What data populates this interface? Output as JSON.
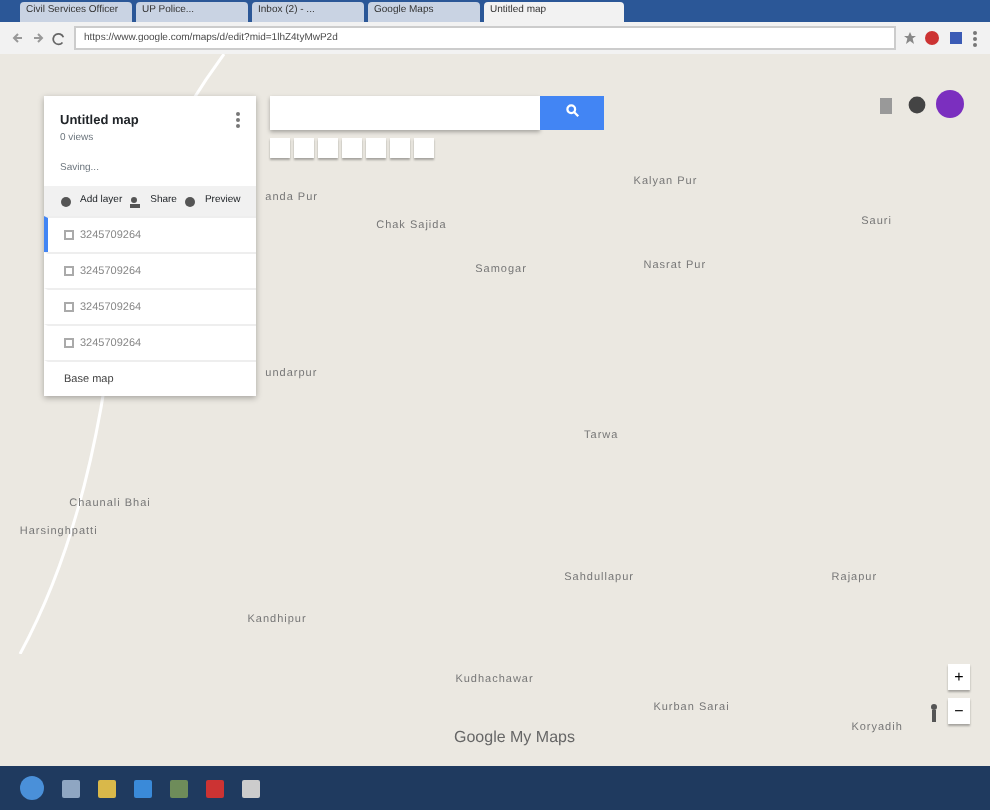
{
  "browser": {
    "tabs": [
      {
        "label": "Civil Services Officer",
        "selected": false
      },
      {
        "label": "UP Police...",
        "selected": false
      },
      {
        "label": "Inbox (2) - ...",
        "selected": false
      },
      {
        "label": "Google Maps",
        "selected": false
      },
      {
        "label": "Untitled map",
        "selected": true
      }
    ],
    "url": "https://www.google.com/maps/d/edit?mid=1lhZ4tyMwP2d"
  },
  "panel": {
    "title": "Untitled map",
    "subtitle": "0 views",
    "status": "Saving...",
    "actions": [
      "Add layer",
      "Share",
      "Preview"
    ],
    "layers": [
      {
        "label": "3245709264",
        "checked": false,
        "selected": true
      },
      {
        "label": "3245709264",
        "checked": false,
        "selected": false
      },
      {
        "label": "3245709264",
        "checked": false,
        "selected": false
      },
      {
        "label": "3245709264",
        "checked": false,
        "selected": false
      }
    ],
    "base_map": "Base map"
  },
  "places": [
    {
      "name": "anda Pur"
    },
    {
      "name": "Chak Sajida"
    },
    {
      "name": "Kalyan Pur"
    },
    {
      "name": "Sauri"
    },
    {
      "name": "Samogar"
    },
    {
      "name": "Nasrat Pur"
    },
    {
      "name": "undarpur"
    },
    {
      "name": "Tarwa"
    },
    {
      "name": "Chaunali Bhai"
    },
    {
      "name": "Harsinghpatti"
    },
    {
      "name": "Sahdullapur"
    },
    {
      "name": "Rajapur"
    },
    {
      "name": "Kandhipur"
    },
    {
      "name": "Kudhachawar"
    },
    {
      "name": "Kurban Sarai"
    },
    {
      "name": "Koryadih"
    }
  ],
  "logo": "Google My Maps",
  "zoom": [
    "+",
    "−"
  ]
}
